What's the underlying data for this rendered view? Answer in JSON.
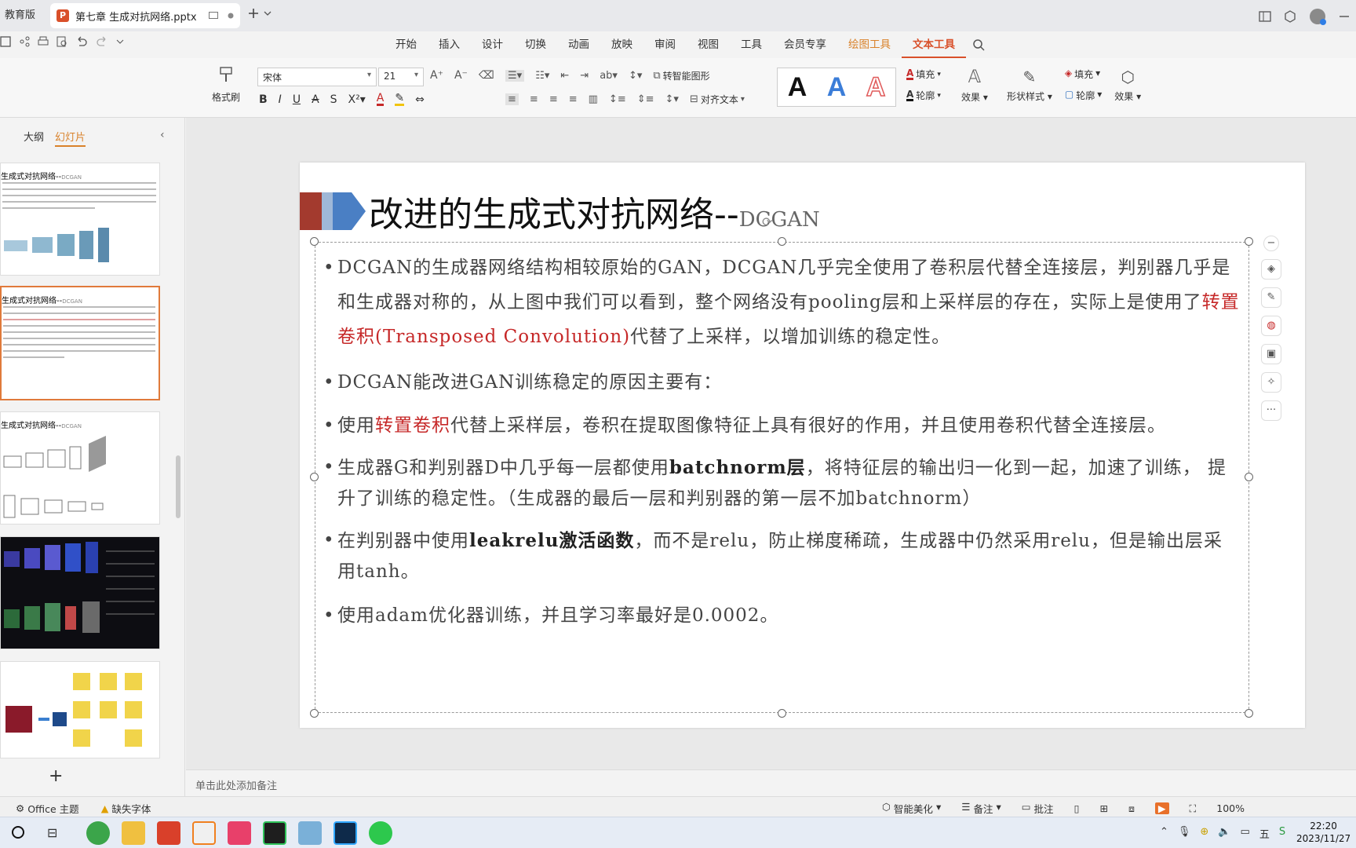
{
  "tabbar": {
    "edition": "教育版",
    "doc_badge": "P",
    "doc_title": "第七章 生成对抗网络.pptx"
  },
  "menu": {
    "items": [
      "开始",
      "插入",
      "设计",
      "切换",
      "动画",
      "放映",
      "审阅",
      "视图",
      "工具",
      "会员专享"
    ],
    "drawing_tools": "绘图工具",
    "text_tools": "文本工具"
  },
  "ribbon": {
    "format_brush": "格式刷",
    "font_name": "宋体",
    "font_size": "21",
    "smart_shape": "转智能图形",
    "align_text": "对齐文本",
    "fill": "填充",
    "outline": "轮廓",
    "effect": "效果",
    "shape_style": "形状样式",
    "shape_fill": "填充",
    "shape_outline": "轮廓",
    "shape_effect": "效果",
    "wordart_letter": "A"
  },
  "left_panel": {
    "tab_outline": "大纲",
    "tab_slides": "幻灯片",
    "thumb_title_1": "生成式对抗网络--",
    "thumb_sub_1": "DCGAN",
    "thumb_title_2": "生成式对抗网络--",
    "thumb_sub_2": "DCGAN",
    "thumb_title_3": "生成式对抗网络--",
    "thumb_sub_3": "DCGAN",
    "add_slide": "+"
  },
  "slide": {
    "title": "改进的生成式对抗网络--",
    "title_suffix": "DCGAN",
    "b1_a": "DCGAN的生成器网络结构相较原始的GAN，DCGAN几乎完全使用了卷积层代替全连接层，判别器几乎是和生成器对称的，从上图中我们可以看到，整个网络没有pooling层和上采样层的存在，实际上是使用了",
    "b1_hl": "转置卷积(Transposed Convolution)",
    "b1_b": "代替了上采样，以增加训练的稳定性。",
    "b2": "DCGAN能改进GAN训练稳定的原因主要有：",
    "b3_a": "使用",
    "b3_hl": "转置卷积",
    "b3_b": "代替上采样层，卷积在提取图像特征上具有很好的作用，并且使用卷积代替全连接层。",
    "b4_a": "生成器G和判别器D中几乎每一层都使用",
    "b4_bd": "batchnorm层",
    "b4_b": "，将特征层的输出归一化到一起，加速了训练， 提升了训练的稳定性。（生成器的最后一层和判别器的第一层不加batchnorm）",
    "b5_a": "在判别器中使用",
    "b5_bd": "leakrelu激活函数",
    "b5_b": "，而不是relu，防止梯度稀疏，生成器中仍然采用relu，但是输出层采用tanh。",
    "b6": "使用adam优化器训练，并且学习率最好是0.0002。"
  },
  "notes": {
    "placeholder": "单击此处添加备注"
  },
  "statusbar": {
    "theme": "Office 主题",
    "missing_font": "缺失字体",
    "smart_beautify": "智能美化",
    "notes": "备注",
    "comments": "批注",
    "zoom": "100%"
  },
  "taskbar": {
    "time": "22:20",
    "date": "2023/11/27",
    "ime": "五"
  },
  "colors": {
    "accent_orange": "#d9502a",
    "highlight_red": "#c62828",
    "deco_red": "#a33a2e",
    "deco_blue": "#4a7fc4"
  }
}
